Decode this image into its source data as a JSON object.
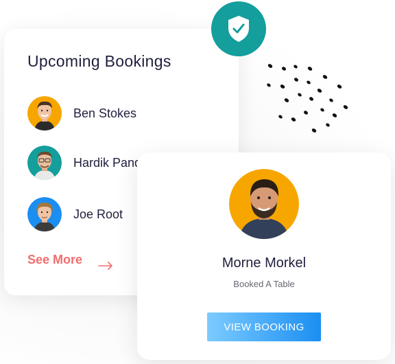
{
  "bookings": {
    "title": "Upcoming Bookings",
    "items": [
      {
        "name": "Ben Stokes",
        "avatar_bg": "#f7a600"
      },
      {
        "name": "Hardik Pand",
        "avatar_bg": "#149e9c"
      },
      {
        "name": "Joe Root",
        "avatar_bg": "#1b8ef2"
      }
    ],
    "see_more_label": "See More",
    "arrow_icon": "arrow-right-icon"
  },
  "badge": {
    "icon": "shield-check-icon",
    "color": "#149e9c"
  },
  "detail": {
    "name": "Morne Morkel",
    "status": "Booked A Table",
    "button_label": "VIEW BOOKING",
    "avatar_bg": "#f7a600"
  },
  "colors": {
    "accent_coral": "#f26d6d",
    "button_gradient_start": "#7ccbff",
    "button_gradient_end": "#1b8ef2",
    "text_dark": "#1f1f3d"
  }
}
